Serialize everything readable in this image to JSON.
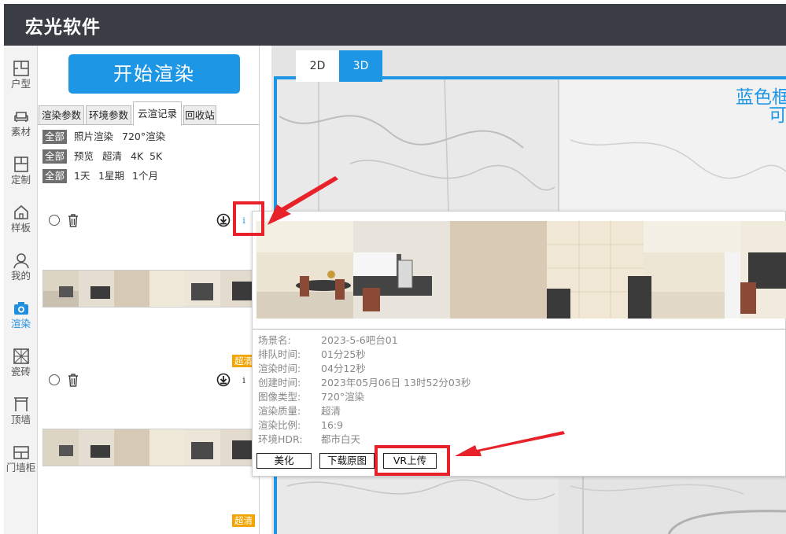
{
  "app": {
    "title": "宏光软件"
  },
  "nav": {
    "items": [
      {
        "id": "layout",
        "label": "户型",
        "icon": "floorplan-icon"
      },
      {
        "id": "material",
        "label": "素材",
        "icon": "sofa-icon"
      },
      {
        "id": "custom",
        "label": "定制",
        "icon": "cabinet-icon"
      },
      {
        "id": "showroom",
        "label": "样板",
        "icon": "house-icon"
      },
      {
        "id": "mine",
        "label": "我的",
        "icon": "user-icon"
      },
      {
        "id": "render",
        "label": "渲染",
        "icon": "camera-icon",
        "active": true
      },
      {
        "id": "tile",
        "label": "瓷砖",
        "icon": "tile-icon"
      },
      {
        "id": "ceiling",
        "label": "顶墙",
        "icon": "ceiling-icon"
      },
      {
        "id": "door",
        "label": "门墙柜",
        "icon": "door-cabinet-icon"
      }
    ]
  },
  "render_panel": {
    "start_button": "开始渲染",
    "tabs": [
      "渲染参数",
      "环境参数",
      "云渲记录",
      "回收站"
    ],
    "active_tab": "云渲记录",
    "filters": {
      "type": [
        "全部",
        "照片渲染",
        "720°渲染"
      ],
      "quality": [
        "全部",
        "预览",
        "超清",
        "4K",
        "5K"
      ],
      "time": [
        "全部",
        "1天",
        "1星期",
        "1个月"
      ]
    },
    "records": [
      {
        "badge": "",
        "info": "i"
      },
      {
        "badge": "超清",
        "info": "i"
      },
      {
        "badge": "超清",
        "info": ""
      }
    ]
  },
  "viewport": {
    "mode_2d": "2D",
    "mode_3d": "3D",
    "active_mode": "3D",
    "overlay_text_line1": "蓝色框",
    "overlay_text_line2": "可"
  },
  "detail_popup": {
    "fields": [
      {
        "key": "场景名:",
        "value": "2023-5-6吧台01"
      },
      {
        "key": "排队时间:",
        "value": "01分25秒"
      },
      {
        "key": "渲染时间:",
        "value": "04分12秒"
      },
      {
        "key": "创建时间:",
        "value": "2023年05月06日 13时52分03秒"
      },
      {
        "key": "图像类型:",
        "value": "720°渲染"
      },
      {
        "key": "渲染质量:",
        "value": "超清"
      },
      {
        "key": "渲染比例:",
        "value": "16:9"
      },
      {
        "key": "环境HDR:",
        "value": "都市白天"
      }
    ],
    "buttons": {
      "beautify": "美化",
      "download": "下载原图",
      "vr_upload": "VR上传"
    }
  },
  "colors": {
    "accent": "#1e96e6",
    "highlight": "#e8222b",
    "badge": "#f2a400",
    "titlebar": "#3a3d44"
  }
}
